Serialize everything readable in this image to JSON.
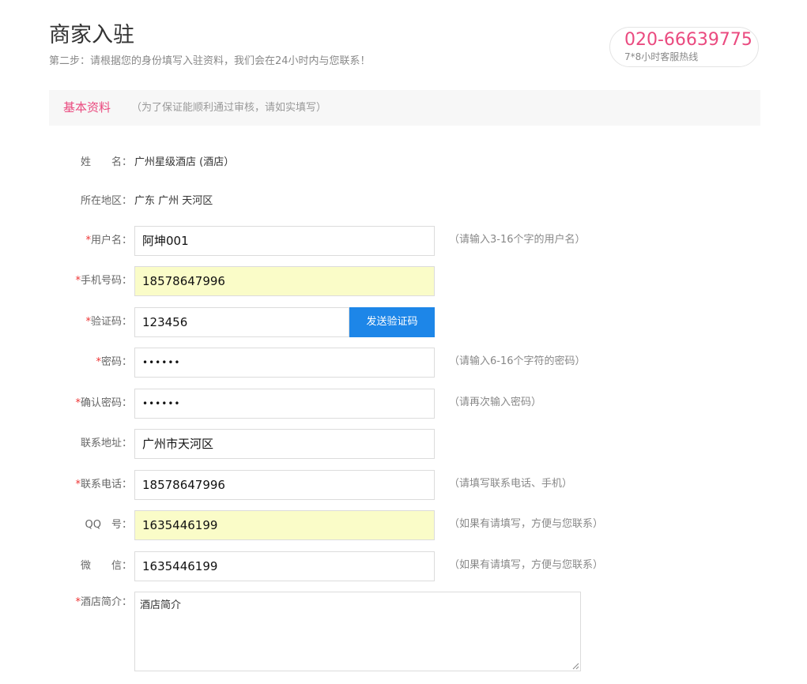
{
  "header": {
    "title": "商家入驻",
    "subtitle": "第二步：请根据您的身份填写入驻资料，我们会在24小时内与您联系！",
    "hotline_number": "020-66639775",
    "hotline_label": "7*8小时客服热线"
  },
  "section": {
    "title": "基本资料",
    "note": "（为了保证能顺利通过审核，请如实填写）"
  },
  "form": {
    "name": {
      "label": "姓　　名：",
      "value": "广州星级酒店 (酒店）"
    },
    "region": {
      "label": "所在地区：",
      "value": "广东 广州 天河区"
    },
    "username": {
      "required": "*",
      "label": "用户名：",
      "value": "阿坤001",
      "hint": "（请输入3-16个字的用户名）"
    },
    "mobile": {
      "required": "*",
      "label": "手机号码：",
      "value": "18578647996"
    },
    "captcha": {
      "required": "*",
      "label": "验证码：",
      "value": "123456",
      "button": "发送验证码"
    },
    "password": {
      "required": "*",
      "label": "密码：",
      "value": "••••••",
      "hint": "（请输入6-16个字符的密码）"
    },
    "confirm_password": {
      "required": "*",
      "label": "确认密码：",
      "value": "••••••",
      "hint": "（请再次输入密码）"
    },
    "address": {
      "label": "联系地址：",
      "value": "广州市天河区"
    },
    "phone": {
      "required": "*",
      "label": "联系电话：",
      "value": "18578647996",
      "hint": "（请填写联系电话、手机）"
    },
    "qq": {
      "label": "QQ　号：",
      "value": "1635446199",
      "hint": "（如果有请填写，方便与您联系）"
    },
    "wechat": {
      "label": "微　　信：",
      "value": "1635446199",
      "hint": "（如果有请填写，方便与您联系）"
    },
    "intro": {
      "required": "*",
      "label": "酒店简介：",
      "value": "酒店简介"
    }
  },
  "colors": {
    "accent_pink": "#ea4a7f",
    "button_blue": "#1d86e8",
    "autofill_yellow": "#fafcc8",
    "required_red": "#e33333"
  },
  "icons": {
    "textarea_resize": "resize-grip-icon"
  }
}
